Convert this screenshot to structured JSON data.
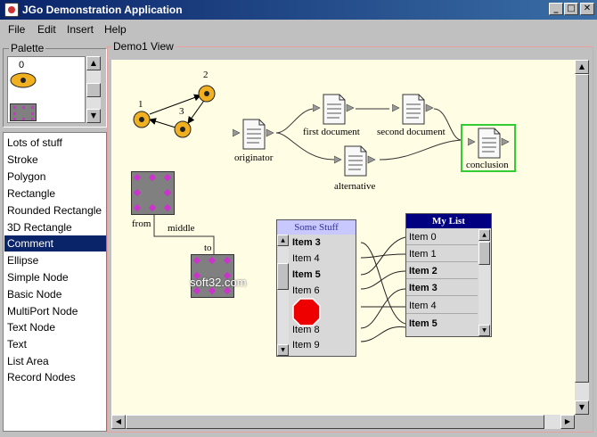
{
  "window": {
    "title": "JGo Demonstration Application"
  },
  "menu": [
    "File",
    "Edit",
    "Insert",
    "Help"
  ],
  "palette": {
    "label": "Palette",
    "item0_label": "0"
  },
  "view": {
    "label": "Demo1 View"
  },
  "node_list": [
    "Lots of stuff",
    "Stroke",
    "Polygon",
    "Rectangle",
    "Rounded Rectangle",
    "3D Rectangle",
    "Comment",
    "Ellipse",
    "Simple Node",
    "Basic Node",
    "MultiPort Node",
    "Text Node",
    "Text",
    "List Area",
    "Record Nodes"
  ],
  "selected_node_type": "Comment",
  "diagram": {
    "num_labels": [
      "1",
      "2",
      "3"
    ],
    "documents": {
      "originator": "originator",
      "first": "first document",
      "second": "second document",
      "alternative": "alternative",
      "conclusion": "conclusion"
    },
    "link_labels": {
      "from": "from",
      "middle": "middle",
      "to": "to"
    },
    "watermark": "soft32.com",
    "some_stuff": {
      "title": "Some Stuff",
      "items": [
        "Item 3",
        "Item 4",
        "Item 5",
        "Item 6",
        "Item 8",
        "Item 9"
      ]
    },
    "my_list": {
      "title": "My List",
      "items": [
        "Item 0",
        "Item 1",
        "Item 2",
        "Item 3",
        "Item 4",
        "Item 5"
      ]
    }
  },
  "colors": {
    "title_bar": "#0a246a",
    "canvas_bg": "#fffde3",
    "node_orange": "#f0b020",
    "selection_green": "#33cc33",
    "stop_red": "#ee0000",
    "port_magenta": "#cc33cc"
  }
}
